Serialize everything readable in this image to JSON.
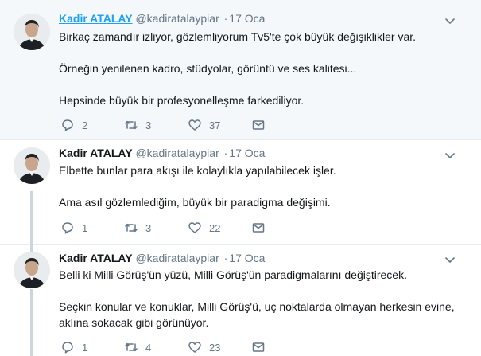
{
  "tweets": [
    {
      "fullname": "Kadir ATALAY",
      "username": "@kadiratalaypiar",
      "separator": "·",
      "time": "17 Oca",
      "paragraphs": [
        "Birkaç zamandır izliyor, gözlemliyorum Tv5'te çok büyük değişiklikler var.",
        "Örneğin yenilenen kadro, stüdyolar, görüntü ve ses kalitesi...",
        "Hepsinde büyük bir profesyonelleşme farkediliyor."
      ],
      "replies": "2",
      "retweets": "3",
      "likes": "37"
    },
    {
      "fullname": "Kadir ATALAY",
      "username": "@kadiratalaypiar",
      "separator": "·",
      "time": "17 Oca",
      "paragraphs": [
        "Elbette bunlar para akışı ile kolaylıkla yapılabilecek işler.",
        "Ama asıl gözlemlediğim, büyük bir paradigma değişimi."
      ],
      "replies": "1",
      "retweets": "3",
      "likes": "22"
    },
    {
      "fullname": "Kadir ATALAY",
      "username": "@kadiratalaypiar",
      "separator": "·",
      "time": "17 Oca",
      "paragraphs": [
        "Belli ki Milli Görüş'ün yüzü, Milli Görüş'ün paradigmalarını değiştirecek.",
        "Seçkin konular ve konuklar, Milli Görüş'ü, uç noktalarda olmayan herkesin evine, aklına sokacak gibi görünüyor."
      ],
      "replies": "1",
      "retweets": "4",
      "likes": "23"
    }
  ],
  "icons": {
    "reply": "reply-icon",
    "retweet": "retweet-icon",
    "like": "heart-icon",
    "dm": "mail-icon",
    "caret": "chevron-down-icon"
  },
  "colors": {
    "link": "#1da1f2",
    "muted": "#657786",
    "thread_line": "#ccd6dd",
    "highlight_bg": "#f5f8fa"
  }
}
